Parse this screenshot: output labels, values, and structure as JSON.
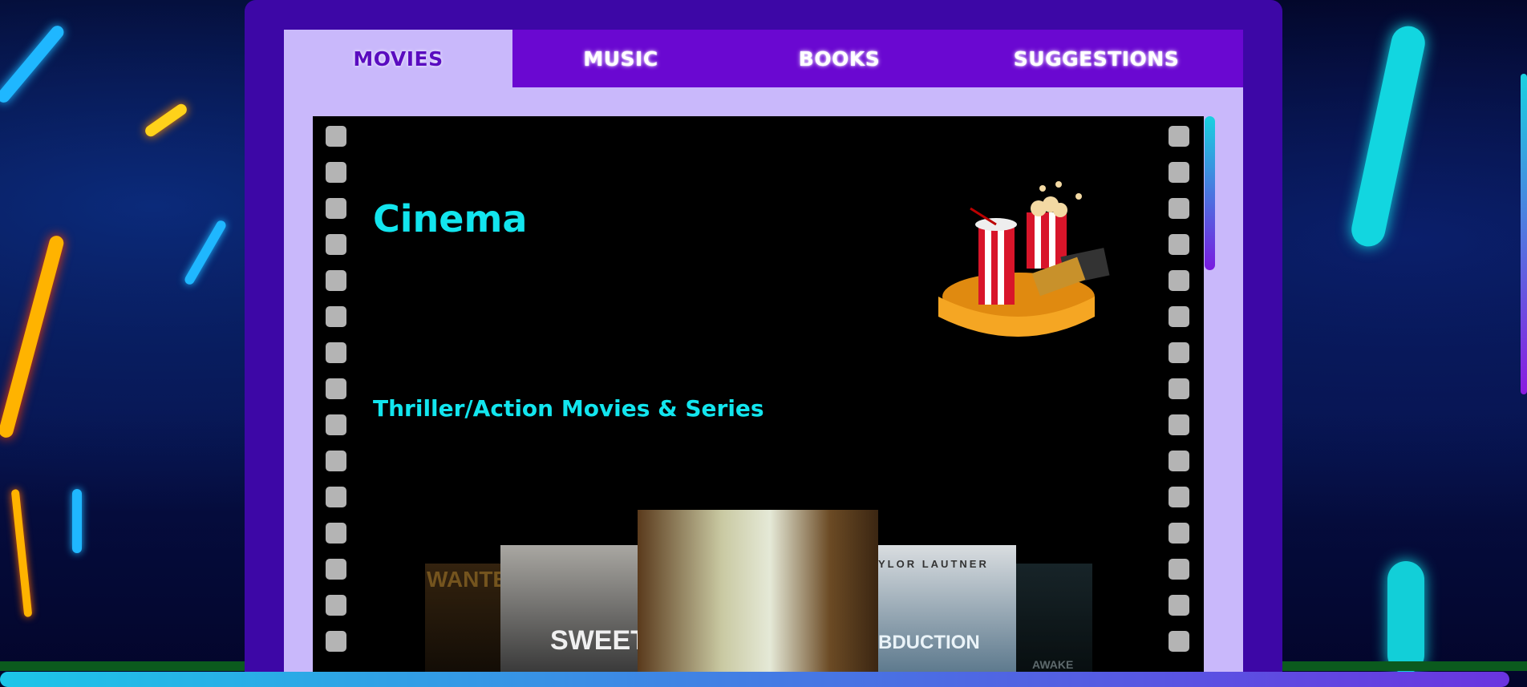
{
  "nav": {
    "tabs": [
      {
        "label": "MOVIES",
        "active": true
      },
      {
        "label": "MUSIC",
        "active": false
      },
      {
        "label": "BOOKS",
        "active": false
      },
      {
        "label": "SUGGESTIONS",
        "active": false
      }
    ]
  },
  "section": {
    "title": "Cinema",
    "subtitle": "Thriller/Action Movies & Series"
  },
  "posters": [
    {
      "text": "WANTE"
    },
    {
      "text": "SWEET"
    },
    {
      "text": ""
    },
    {
      "text": "YLOR LAUTNER",
      "extra": "BDUCTION"
    },
    {
      "text": "AWAKE"
    }
  ],
  "colors": {
    "panel": "#3d07a6",
    "tab_bar": "#6a08d1",
    "tab_active_bg": "#c9b8fb",
    "heading": "#12e5ee"
  },
  "icons": [
    "popcorn-cinema-icon"
  ]
}
